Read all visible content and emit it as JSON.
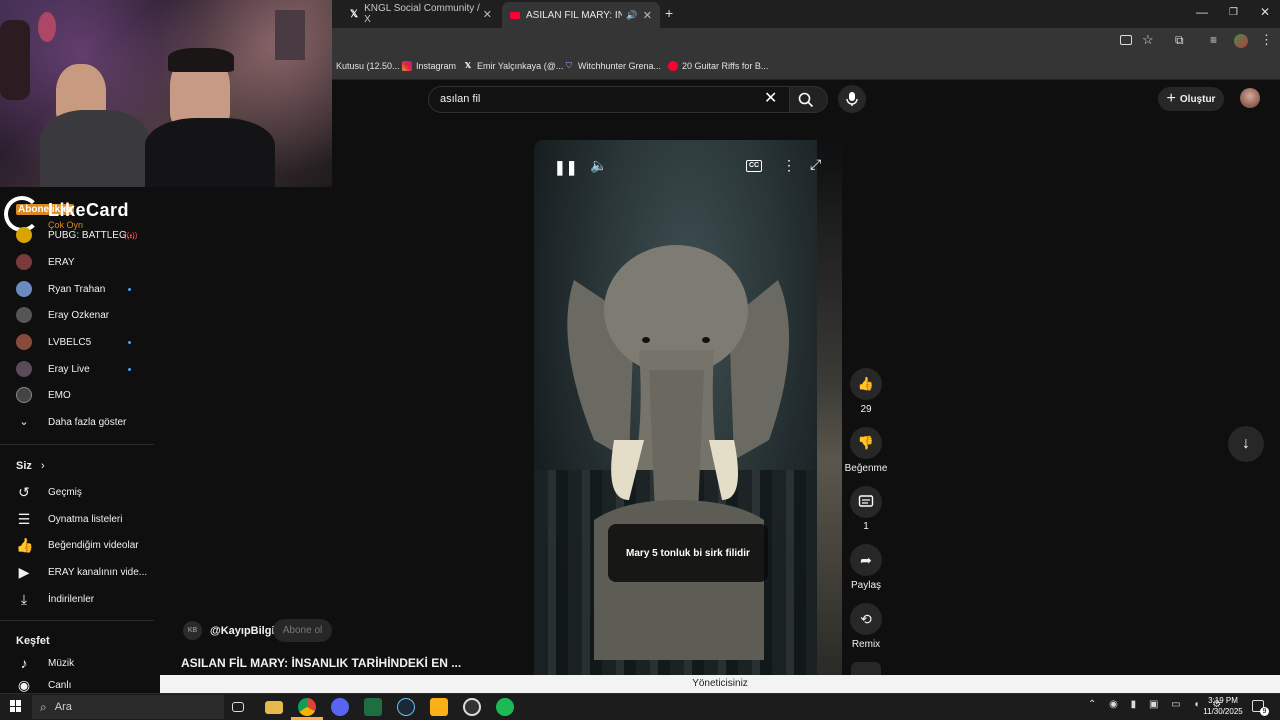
{
  "browser": {
    "tabs": [
      {
        "label": "KNGL Social Community / X",
        "icon": "x-logo-icon"
      },
      {
        "label": "ASILAN FİL MARY: İNSANL",
        "icon": "youtube-icon"
      }
    ],
    "bookmarks": [
      {
        "label": "Kutusu (12.50...",
        "icon": "bookmark-icon"
      },
      {
        "label": "Instagram",
        "icon": "instagram-icon"
      },
      {
        "label": "Emir Yalçınkaya (@...",
        "icon": "x-logo-icon"
      },
      {
        "label": "Witchhunter Grena...",
        "icon": "shield-icon"
      },
      {
        "label": "20 Guitar Riffs for B...",
        "icon": "youtube-icon"
      }
    ]
  },
  "header": {
    "search_value": "asılan fil",
    "create_label": "Oluştur"
  },
  "overlay": {
    "brand": "LikeCard",
    "tagline": "Çok Oyn",
    "abone": "Abonelikler"
  },
  "sidebar": {
    "subscriptions": [
      {
        "label": "PUBG: BATTLEG...",
        "live": true,
        "color": "#d9a400"
      },
      {
        "label": "ERAY",
        "dot": false,
        "color": "#7a3a3a"
      },
      {
        "label": "Ryan Trahan",
        "dot": true,
        "color": "#6a8ac0"
      },
      {
        "label": "Eray Ozkenar",
        "dot": false,
        "color": "#555555"
      },
      {
        "label": "LVBELC5",
        "dot": true,
        "color": "#8a4a3a"
      },
      {
        "label": "Eray Live",
        "dot": true,
        "color": "#5a4a5a"
      },
      {
        "label": "EMO",
        "dot": false,
        "color": "#444444"
      }
    ],
    "show_more": "Daha fazla göster",
    "you_heading": "Siz",
    "you_items": [
      {
        "label": "Geçmiş",
        "icon": "history-icon"
      },
      {
        "label": "Oynatma listeleri",
        "icon": "playlist-icon"
      },
      {
        "label": "Beğendiğim videolar",
        "icon": "thumbs-up-icon"
      },
      {
        "label": "ERAY kanalının vide...",
        "icon": "video-icon"
      },
      {
        "label": "İndirilenler",
        "icon": "download-icon"
      }
    ],
    "explore_heading": "Keşfet",
    "explore_items": [
      {
        "label": "Müzik",
        "icon": "music-icon"
      },
      {
        "label": "Canlı",
        "icon": "live-icon"
      }
    ]
  },
  "video": {
    "subtitle": "Mary 5 tonluk bi sirk filidir",
    "channel": "@KayıpBilgi",
    "channel_avatar_text": "KB",
    "subscribe": "Abone ol",
    "title": "ASILAN FİL MARY: İNSANLIK TARİHİNDEKİ EN ..."
  },
  "actions": {
    "likes": "29",
    "dislike": "Beğenme",
    "comments": "1",
    "share": "Paylaş",
    "remix": "Remix"
  },
  "admin_bar": "Yöneticisiniz",
  "taskbar": {
    "search": "Ara",
    "time": "3:19 PM",
    "date": "11/30/2025",
    "notif": "9"
  }
}
